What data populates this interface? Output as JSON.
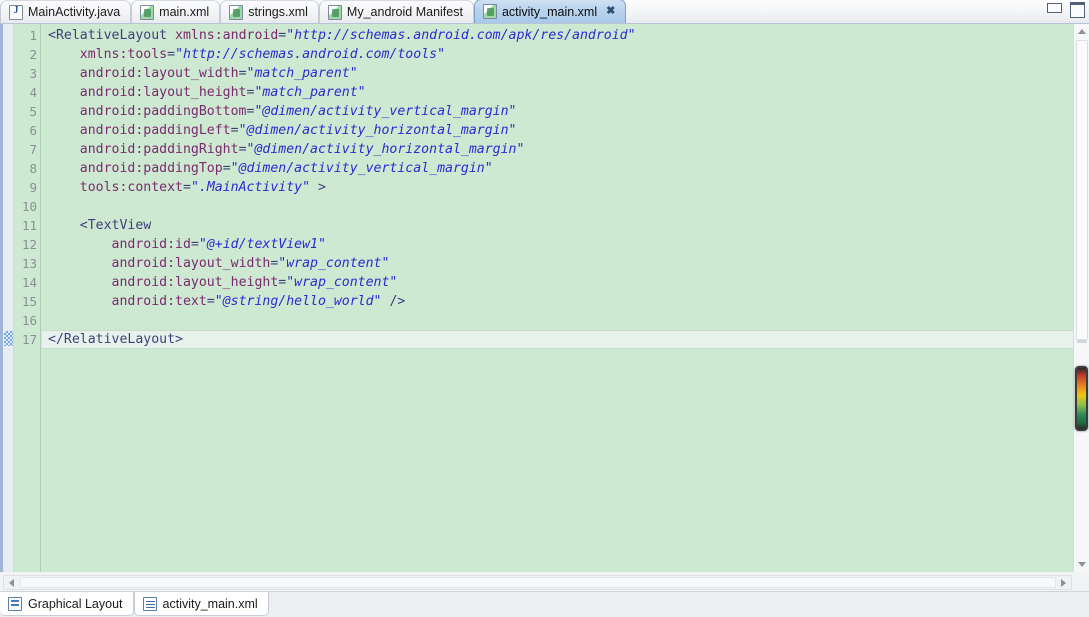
{
  "window": {
    "minimize_label": "Minimize",
    "maximize_label": "Maximize"
  },
  "tabs": [
    {
      "label": "MainActivity.java",
      "icon": "java-file-icon",
      "active": false,
      "closable": false
    },
    {
      "label": "main.xml",
      "icon": "xml-file-icon",
      "active": false,
      "closable": false
    },
    {
      "label": "strings.xml",
      "icon": "xml-file-icon",
      "active": false,
      "closable": false
    },
    {
      "label": "My_android Manifest",
      "icon": "xml-file-icon",
      "active": false,
      "closable": false
    },
    {
      "label": "activity_main.xml",
      "icon": "xml-file-icon",
      "active": true,
      "closable": true,
      "close_glyph": "✖"
    }
  ],
  "editor": {
    "background_color": "#cde9d2",
    "current_line": 17,
    "total_lines": 17,
    "line_numbers": [
      "1",
      "2",
      "3",
      "4",
      "5",
      "6",
      "7",
      "8",
      "9",
      "10",
      "11",
      "12",
      "13",
      "14",
      "15",
      "16",
      "17"
    ],
    "colors": {
      "tag": "#3f3f7a",
      "attribute": "#7a2a6e",
      "string": "#2b2bd0",
      "gutter_text": "#8a8f94",
      "current_line_bg": "#e7f2ec"
    },
    "lines": [
      {
        "n": 1,
        "indent": 0,
        "tokens": [
          {
            "t": "tag",
            "v": "<RelativeLayout"
          },
          {
            "t": "plain",
            "v": " "
          },
          {
            "t": "attr",
            "v": "xmlns:android"
          },
          {
            "t": "punc",
            "v": "="
          },
          {
            "t": "str",
            "v": "\"http://schemas.android.com/apk/res/android\""
          }
        ]
      },
      {
        "n": 2,
        "indent": 4,
        "tokens": [
          {
            "t": "attr",
            "v": "xmlns:tools"
          },
          {
            "t": "punc",
            "v": "="
          },
          {
            "t": "str",
            "v": "\"http://schemas.android.com/tools\""
          }
        ]
      },
      {
        "n": 3,
        "indent": 4,
        "tokens": [
          {
            "t": "attr",
            "v": "android:layout_width"
          },
          {
            "t": "punc",
            "v": "="
          },
          {
            "t": "str",
            "v": "\"match_parent\""
          }
        ]
      },
      {
        "n": 4,
        "indent": 4,
        "tokens": [
          {
            "t": "attr",
            "v": "android:layout_height"
          },
          {
            "t": "punc",
            "v": "="
          },
          {
            "t": "str",
            "v": "\"match_parent\""
          }
        ]
      },
      {
        "n": 5,
        "indent": 4,
        "tokens": [
          {
            "t": "attr",
            "v": "android:paddingBottom"
          },
          {
            "t": "punc",
            "v": "="
          },
          {
            "t": "str",
            "v": "\"@dimen/activity_vertical_margin\""
          }
        ]
      },
      {
        "n": 6,
        "indent": 4,
        "tokens": [
          {
            "t": "attr",
            "v": "android:paddingLeft"
          },
          {
            "t": "punc",
            "v": "="
          },
          {
            "t": "str",
            "v": "\"@dimen/activity_horizontal_margin\""
          }
        ]
      },
      {
        "n": 7,
        "indent": 4,
        "tokens": [
          {
            "t": "attr",
            "v": "android:paddingRight"
          },
          {
            "t": "punc",
            "v": "="
          },
          {
            "t": "str",
            "v": "\"@dimen/activity_horizontal_margin\""
          }
        ]
      },
      {
        "n": 8,
        "indent": 4,
        "tokens": [
          {
            "t": "attr",
            "v": "android:paddingTop"
          },
          {
            "t": "punc",
            "v": "="
          },
          {
            "t": "str",
            "v": "\"@dimen/activity_vertical_margin\""
          }
        ]
      },
      {
        "n": 9,
        "indent": 4,
        "tokens": [
          {
            "t": "attr",
            "v": "tools:context"
          },
          {
            "t": "punc",
            "v": "="
          },
          {
            "t": "str",
            "v": "\".MainActivity\""
          },
          {
            "t": "plain",
            "v": " "
          },
          {
            "t": "tag",
            "v": ">"
          }
        ]
      },
      {
        "n": 10,
        "indent": 0,
        "tokens": []
      },
      {
        "n": 11,
        "indent": 4,
        "tokens": [
          {
            "t": "tag",
            "v": "<TextView"
          }
        ]
      },
      {
        "n": 12,
        "indent": 8,
        "tokens": [
          {
            "t": "attr",
            "v": "android:id"
          },
          {
            "t": "punc",
            "v": "="
          },
          {
            "t": "str",
            "v": "\"@+id/textView1\""
          }
        ]
      },
      {
        "n": 13,
        "indent": 8,
        "tokens": [
          {
            "t": "attr",
            "v": "android:layout_width"
          },
          {
            "t": "punc",
            "v": "="
          },
          {
            "t": "str",
            "v": "\"wrap_content\""
          }
        ]
      },
      {
        "n": 14,
        "indent": 8,
        "tokens": [
          {
            "t": "attr",
            "v": "android:layout_height"
          },
          {
            "t": "punc",
            "v": "="
          },
          {
            "t": "str",
            "v": "\"wrap_content\""
          }
        ]
      },
      {
        "n": 15,
        "indent": 8,
        "tokens": [
          {
            "t": "attr",
            "v": "android:text"
          },
          {
            "t": "punc",
            "v": "="
          },
          {
            "t": "str",
            "v": "\"@string/hello_world\""
          },
          {
            "t": "plain",
            "v": " "
          },
          {
            "t": "tag",
            "v": "/>"
          }
        ]
      },
      {
        "n": 16,
        "indent": 0,
        "tokens": []
      },
      {
        "n": 17,
        "indent": 0,
        "tokens": [
          {
            "t": "tag",
            "v": "</RelativeLayout>"
          }
        ]
      }
    ]
  },
  "bottom_tabs": [
    {
      "label": "Graphical Layout",
      "icon": "graphical-layout-icon",
      "active": false
    },
    {
      "label": "activity_main.xml",
      "icon": "xml-source-icon",
      "active": true
    }
  ],
  "scrollbars": {
    "vertical_up_glyph": "▲",
    "vertical_down_glyph": "▼",
    "horizontal_left_glyph": "◀",
    "horizontal_right_glyph": "▶"
  }
}
